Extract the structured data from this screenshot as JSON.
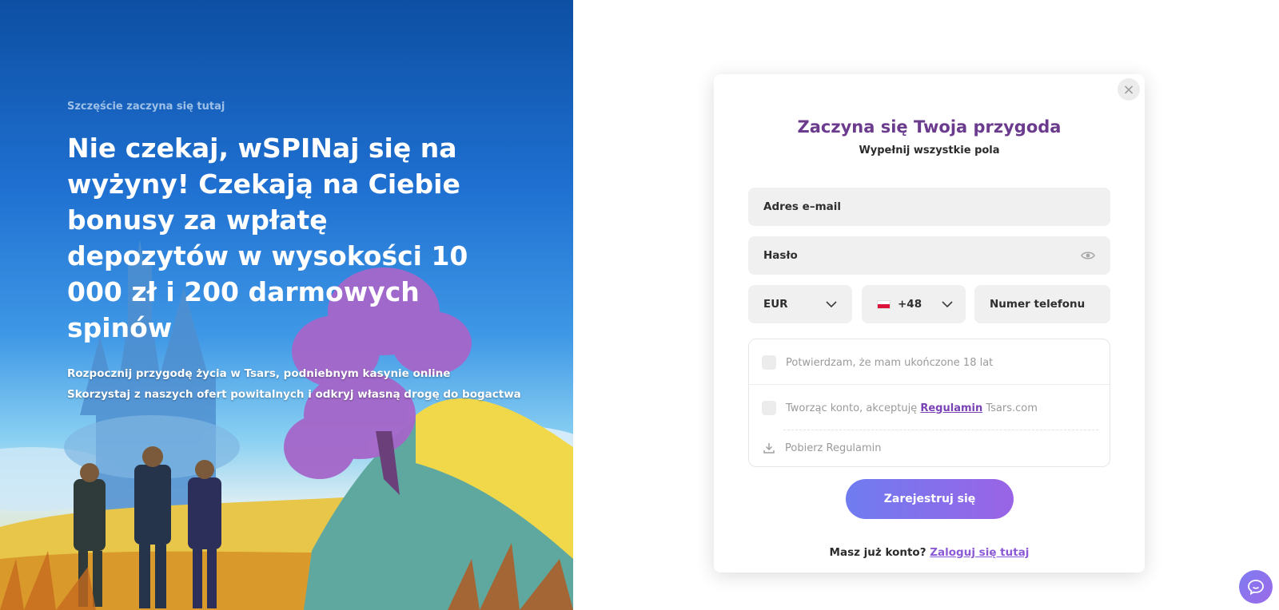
{
  "hero": {
    "kicker": "Szczęście zaczyna się tutaj",
    "title": "Nie czekaj, wSPINaj się na wyżyny! Czekają na Ciebie bonusy za wpłatę depozytów w wysokości 10 000 zł i 200 darmowych spinów",
    "desc_line1": "Rozpocznij przygodę życia w Tsars, podniebnym kasynie online",
    "desc_line2": "Skorzystaj z naszych ofert powitalnych i odkryj własną drogę do bogactwa"
  },
  "modal": {
    "close_icon": "×",
    "title": "Zaczyna się Twoja przygoda",
    "subtitle": "Wypełnij wszystkie pola",
    "email_placeholder": "Adres e–mail",
    "password_placeholder": "Hasło",
    "currency_selected": "EUR",
    "phone_prefix_selected": "+48",
    "phone_placeholder": "Numer telefonu",
    "age_confirm": "Potwierdzam, że mam ukończone 18 lat",
    "terms_prefix": "Tworząc konto, akceptuję",
    "terms_link": "Regulamin",
    "terms_suffix": "Tsars.com",
    "download_terms": "Pobierz Regulamin",
    "register_button": "Zarejestruj się",
    "have_account": "Masz już konto?",
    "login_link": "Zaloguj się tutaj"
  },
  "icons": {
    "close": "close-icon",
    "password_toggle": "eye-icon",
    "dropdown": "chevron-down-icon",
    "flag": "poland-flag-icon",
    "download": "download-icon",
    "chat": "chat-icon"
  },
  "colors": {
    "accent_purple": "#6b3b8e",
    "link_purple": "#7a43b5",
    "button_gradient_start": "#6f7cf0",
    "button_gradient_end": "#9a64e6",
    "field_bg": "#f0f0f0"
  }
}
